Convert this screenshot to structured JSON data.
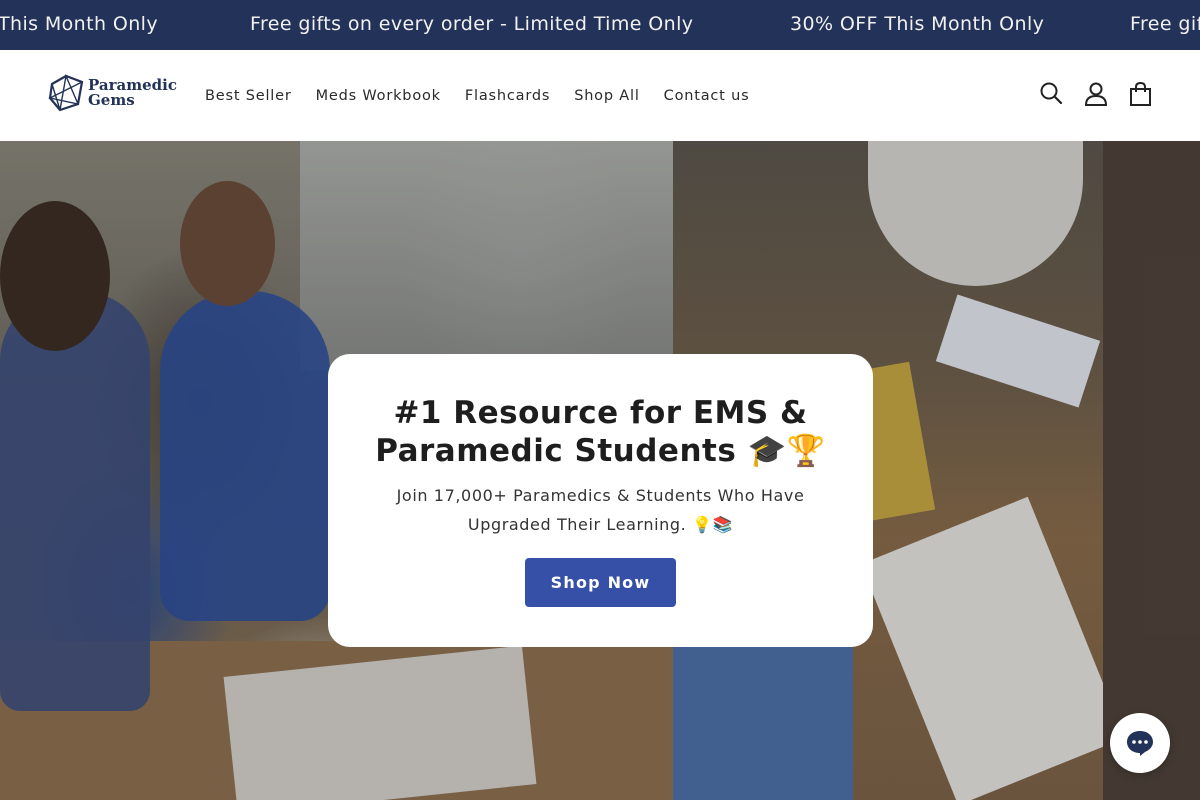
{
  "announcement": {
    "items": [
      "This Month Only",
      "Free gifts on every order - Limited Time Only",
      "30% OFF This Month Only",
      "Free gift"
    ]
  },
  "header": {
    "logo": {
      "line1": "Paramedic",
      "line2": "Gems"
    },
    "nav": [
      "Best Seller",
      "Meds Workbook",
      "Flashcards",
      "Shop All",
      "Contact us"
    ],
    "icons": [
      "search-icon",
      "account-icon",
      "cart-icon"
    ]
  },
  "hero": {
    "title": "#1 Resource for EMS & Paramedic Students 🎓🏆",
    "subtitle": "Join 17,000+ Paramedics & Students Who Have Upgraded Their Learning. 💡📚",
    "cta_label": "Shop Now"
  },
  "colors": {
    "announcement_bg": "#233258",
    "accent": "#3650a8",
    "brand": "#233258"
  },
  "chat": {
    "icon": "chat-icon"
  }
}
